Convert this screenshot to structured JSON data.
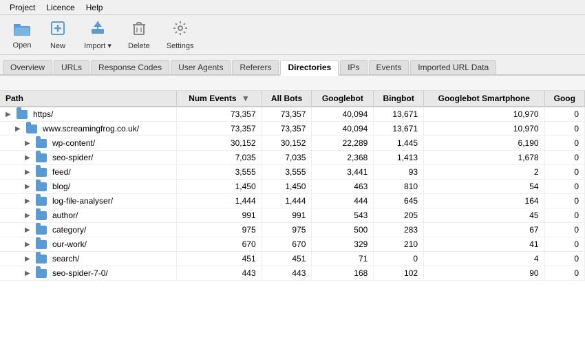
{
  "menubar": {
    "items": [
      "Project",
      "Licence",
      "Help"
    ]
  },
  "toolbar": {
    "buttons": [
      {
        "label": "Open",
        "icon": "📂",
        "name": "open-button"
      },
      {
        "label": "New",
        "icon": "➕",
        "name": "new-button"
      },
      {
        "label": "Import",
        "icon": "⬇",
        "name": "import-button"
      },
      {
        "label": "Delete",
        "icon": "🗑",
        "name": "delete-button"
      },
      {
        "label": "Settings",
        "icon": "⚙",
        "name": "settings-button"
      }
    ]
  },
  "tabs": [
    {
      "label": "Overview",
      "active": false
    },
    {
      "label": "URLs",
      "active": false
    },
    {
      "label": "Response Codes",
      "active": false
    },
    {
      "label": "User Agents",
      "active": false
    },
    {
      "label": "Referers",
      "active": false
    },
    {
      "label": "Directories",
      "active": true
    },
    {
      "label": "IPs",
      "active": false
    },
    {
      "label": "Events",
      "active": false
    },
    {
      "label": "Imported URL Data",
      "active": false
    }
  ],
  "table": {
    "columns": [
      "Path",
      "Num Events",
      "All Bots",
      "Googlebot",
      "Bingbot",
      "Googlebot Smartphone",
      "Goog"
    ],
    "rows": [
      {
        "indent": 0,
        "expanded": true,
        "path": "https/",
        "numEvents": "73,357",
        "allBots": "73,357",
        "googlebot": "40,094",
        "bingbot": "13,671",
        "googlebotSmartphone": "10,970",
        "goog": "0"
      },
      {
        "indent": 1,
        "expanded": true,
        "path": "www.screamingfrog.co.uk/",
        "numEvents": "73,357",
        "allBots": "73,357",
        "googlebot": "40,094",
        "bingbot": "13,671",
        "googlebotSmartphone": "10,970",
        "goog": "0"
      },
      {
        "indent": 2,
        "expanded": true,
        "path": "wp-content/",
        "numEvents": "30,152",
        "allBots": "30,152",
        "googlebot": "22,289",
        "bingbot": "1,445",
        "googlebotSmartphone": "6,190",
        "goog": "0"
      },
      {
        "indent": 2,
        "expanded": true,
        "path": "seo-spider/",
        "numEvents": "7,035",
        "allBots": "7,035",
        "googlebot": "2,368",
        "bingbot": "1,413",
        "googlebotSmartphone": "1,678",
        "goog": "0"
      },
      {
        "indent": 2,
        "expanded": false,
        "path": "feed/",
        "numEvents": "3,555",
        "allBots": "3,555",
        "googlebot": "3,441",
        "bingbot": "93",
        "googlebotSmartphone": "2",
        "goog": "0"
      },
      {
        "indent": 2,
        "expanded": true,
        "path": "blog/",
        "numEvents": "1,450",
        "allBots": "1,450",
        "googlebot": "463",
        "bingbot": "810",
        "googlebotSmartphone": "54",
        "goog": "0"
      },
      {
        "indent": 2,
        "expanded": false,
        "path": "log-file-analyser/",
        "numEvents": "1,444",
        "allBots": "1,444",
        "googlebot": "444",
        "bingbot": "645",
        "googlebotSmartphone": "164",
        "goog": "0"
      },
      {
        "indent": 2,
        "expanded": true,
        "path": "author/",
        "numEvents": "991",
        "allBots": "991",
        "googlebot": "543",
        "bingbot": "205",
        "googlebotSmartphone": "45",
        "goog": "0"
      },
      {
        "indent": 2,
        "expanded": false,
        "path": "category/",
        "numEvents": "975",
        "allBots": "975",
        "googlebot": "500",
        "bingbot": "283",
        "googlebotSmartphone": "67",
        "goog": "0"
      },
      {
        "indent": 2,
        "expanded": false,
        "path": "our-work/",
        "numEvents": "670",
        "allBots": "670",
        "googlebot": "329",
        "bingbot": "210",
        "googlebotSmartphone": "41",
        "goog": "0"
      },
      {
        "indent": 2,
        "expanded": false,
        "path": "search/",
        "numEvents": "451",
        "allBots": "451",
        "googlebot": "71",
        "bingbot": "0",
        "googlebotSmartphone": "4",
        "goog": "0"
      },
      {
        "indent": 2,
        "expanded": true,
        "path": "seo-spider-7-0/",
        "numEvents": "443",
        "allBots": "443",
        "googlebot": "168",
        "bingbot": "102",
        "googlebotSmartphone": "90",
        "goog": "0"
      }
    ]
  }
}
